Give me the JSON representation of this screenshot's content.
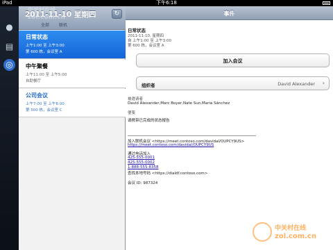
{
  "status_bar": {
    "carrier": "iPad",
    "time": "下午6:18",
    "battery_label": ""
  },
  "list_header": {
    "date": "2011-11-10 星期四",
    "filter_all": "全部",
    "filter_offline": "联机",
    "refresh_glyph": "↻"
  },
  "rail": {
    "icons": [
      "person-icon",
      "chat-icon",
      "globe-icon"
    ]
  },
  "events": [
    {
      "title": "日常状态",
      "line1": "上午1:00 至 上午3:00",
      "line2": "第 600 栋，会议室 A"
    },
    {
      "title": "中午聚餐",
      "line1": "上午11:00 至 上午5:00",
      "line2": "自助餐厅"
    },
    {
      "title": "公司会议",
      "line1": "上午7:00 至 上午8:00",
      "line2": "第 500 栋，会议室 C"
    }
  ],
  "detail": {
    "header": "事件",
    "event_title": "日常状态",
    "meta": [
      "2011-11-10, 星期四",
      "自 上午1:00 至 上午3:00",
      "第 600 栋，会议室 A"
    ],
    "join_label": "加入会议",
    "organizer_label": "组织者",
    "organizer_value": "David Alexander",
    "invitees_label": "被邀请者",
    "invitees": "David Alexander,Marc Boyer,Nate Sun,Maria Sánchez",
    "notes_label": "便笺",
    "notes_text": "请携带已完成的状态报告",
    "online_label": "加入联机会议 <https://meet.contoso.com/davidal/OUPCY9US>",
    "online_link": "https://meet.contoso.com/davidal/OUPCY9US",
    "phone_label": "通过电话加入",
    "phones": [
      "425-555-0001",
      "425-555-0002",
      "1-888-555-8358"
    ],
    "local_label": "查找本地号码 <https://dialdf.contoso.com>",
    "meeting_id": "会议 ID: 987324"
  },
  "watermark": {
    "top": "中关村在线",
    "bottom": "zol.com.cn"
  }
}
